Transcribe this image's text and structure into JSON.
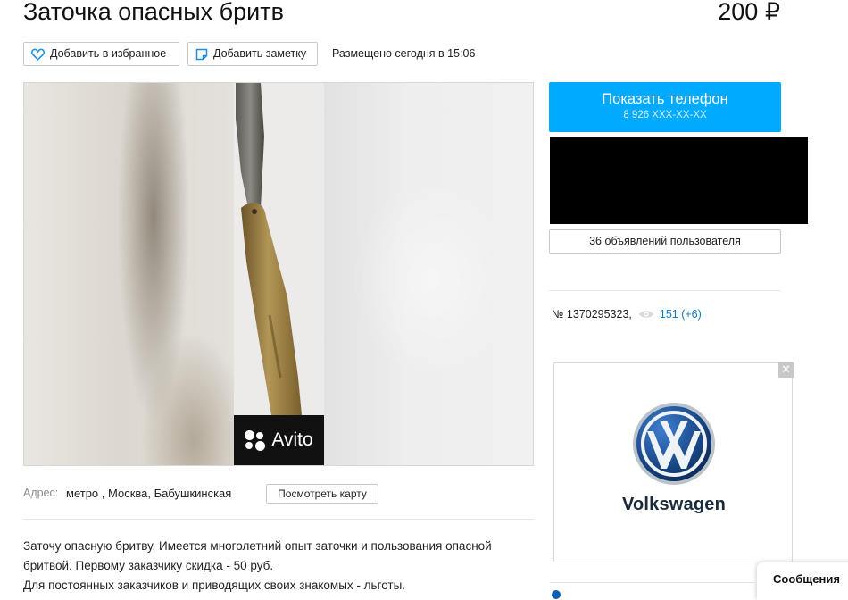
{
  "listing": {
    "title": "Заточка опасных бритв",
    "price": "200 ₽"
  },
  "actions": {
    "favorite_label": "Добавить в избранное",
    "note_label": "Добавить заметку",
    "posted": "Размещено сегодня в 15:06"
  },
  "gallery": {
    "watermark": "Avito"
  },
  "address": {
    "label": "Адрес:",
    "value": "метро , Москва, Бабушкинская",
    "map_button": "Посмотреть карту"
  },
  "description": {
    "lines": [
      "Заточу опасную бритву. Имеется многолетний опыт заточки и пользования опасной",
      "бритвой. Первому заказчику скидка - 50 руб.",
      "Для постоянных заказчиков и приводящих своих знакомых - льготы."
    ]
  },
  "seller": {
    "show_phone_label": "Показать телефон",
    "phone_masked": "8 926 XXX-XX-XX",
    "ads_count_label": "36 объявлений пользователя"
  },
  "meta": {
    "number": "№ 1370295323,",
    "views": "151 (+6)"
  },
  "advert": {
    "brand": "Volkswagen",
    "close_symbol": "✕"
  },
  "messages": {
    "label": "Сообщения"
  },
  "colors": {
    "accent": "#00aaff",
    "link": "#0a7fc1",
    "vw_blue": "#1a4a8a"
  }
}
